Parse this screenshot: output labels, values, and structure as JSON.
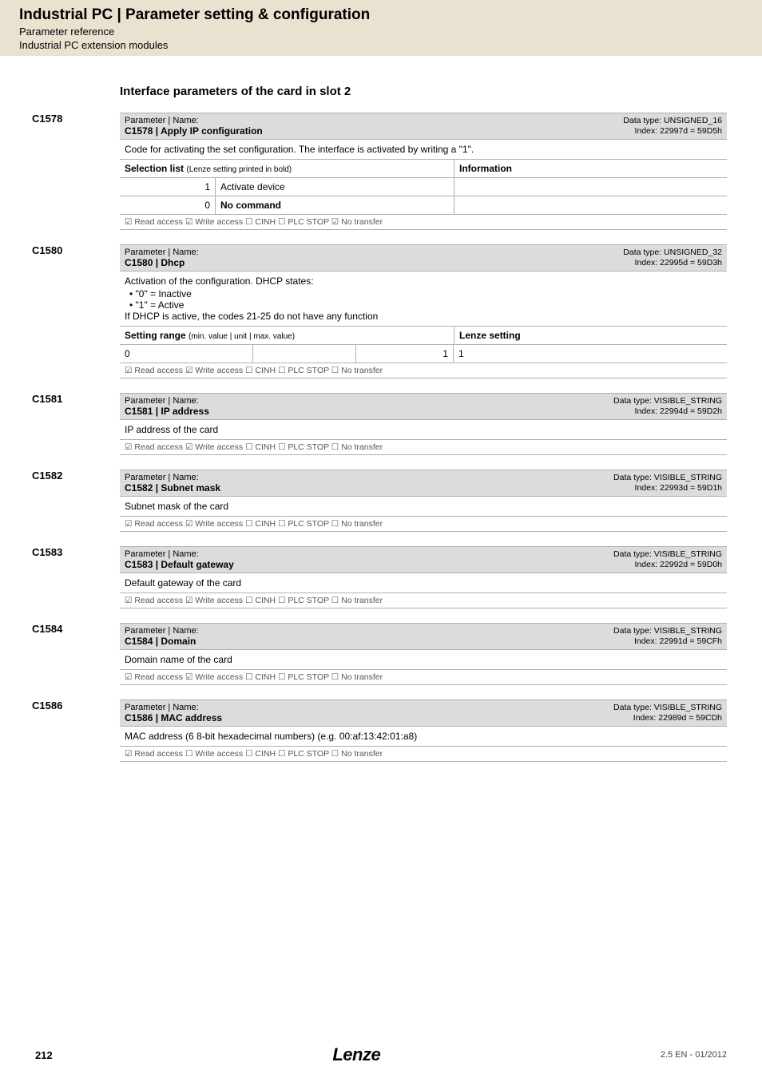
{
  "header": {
    "breadcrumb": "Industrial PC | Parameter setting & configuration",
    "sub1": "Parameter reference",
    "sub2": "Industrial PC extension modules"
  },
  "section_title": "Interface parameters of the card in slot 2",
  "params": [
    {
      "code": "C1578",
      "name_label": "Parameter | Name:",
      "title": "C1578 | Apply IP configuration",
      "dtype": "Data type: UNSIGNED_16",
      "index": "Index: 22997d = 59D5h",
      "desc": "Code for activating the set configuration. The interface is activated by writing a \"1\".",
      "sel_header_left": "Selection list",
      "sel_header_left_small": "(Lenze setting printed in bold)",
      "sel_header_right": "Information",
      "rows": [
        {
          "num": "1",
          "label": "Activate device",
          "bold": false
        },
        {
          "num": "0",
          "label": "No command",
          "bold": true
        }
      ],
      "access": "☑ Read access  ☑ Write access  ☐ CINH  ☐ PLC STOP  ☑ No transfer"
    },
    {
      "code": "C1580",
      "name_label": "Parameter | Name:",
      "title": "C1580 | Dhcp",
      "dtype": "Data type: UNSIGNED_32",
      "index": "Index: 22995d = 59D3h",
      "desc_lines": [
        "Activation of the configuration. DHCP states:"
      ],
      "desc_bullets": [
        "\"0\" = Inactive",
        "\"1\" = Active"
      ],
      "desc_after": "If DHCP is active, the codes 21-25 do not have any function",
      "setting_header_left": "Setting range",
      "setting_header_left_small": "(min. value | unit | max. value)",
      "setting_header_right": "Lenze setting",
      "setting_row": {
        "min": "0",
        "unit": "",
        "max": "1",
        "lenze": "1"
      },
      "access": "☑ Read access  ☑ Write access  ☐ CINH  ☐ PLC STOP  ☐ No transfer"
    },
    {
      "code": "C1581",
      "name_label": "Parameter | Name:",
      "title": "C1581 | IP address",
      "dtype": "Data type: VISIBLE_STRING",
      "index": "Index: 22994d = 59D2h",
      "desc": "IP address of the card",
      "access": "☑ Read access  ☑ Write access  ☐ CINH  ☐ PLC STOP  ☐ No transfer"
    },
    {
      "code": "C1582",
      "name_label": "Parameter | Name:",
      "title": "C1582 | Subnet mask",
      "dtype": "Data type: VISIBLE_STRING",
      "index": "Index: 22993d = 59D1h",
      "desc": "Subnet mask of the card",
      "access": "☑ Read access  ☑ Write access  ☐ CINH  ☐ PLC STOP  ☐ No transfer"
    },
    {
      "code": "C1583",
      "name_label": "Parameter | Name:",
      "title": "C1583 | Default gateway",
      "dtype": "Data type: VISIBLE_STRING",
      "index": "Index: 22992d = 59D0h",
      "desc": "Default gateway of the card",
      "access": "☑ Read access  ☑ Write access  ☐ CINH  ☐ PLC STOP  ☐ No transfer"
    },
    {
      "code": "C1584",
      "name_label": "Parameter | Name:",
      "title": "C1584 | Domain",
      "dtype": "Data type: VISIBLE_STRING",
      "index": "Index: 22991d = 59CFh",
      "desc": "Domain name of the card",
      "access": "☑ Read access  ☑ Write access  ☐ CINH  ☐ PLC STOP  ☐ No transfer"
    },
    {
      "code": "C1586",
      "name_label": "Parameter | Name:",
      "title": "C1586 | MAC address",
      "dtype": "Data type: VISIBLE_STRING",
      "index": "Index: 22989d = 59CDh",
      "desc": "MAC address (6 8-bit hexadecimal numbers) (e.g. 00:af:13:42:01:a8)",
      "access": "☑ Read access  ☐ Write access  ☐ CINH  ☐ PLC STOP  ☐ No transfer"
    }
  ],
  "footer": {
    "page": "212",
    "logo": "Lenze",
    "version": "2.5 EN - 01/2012"
  }
}
